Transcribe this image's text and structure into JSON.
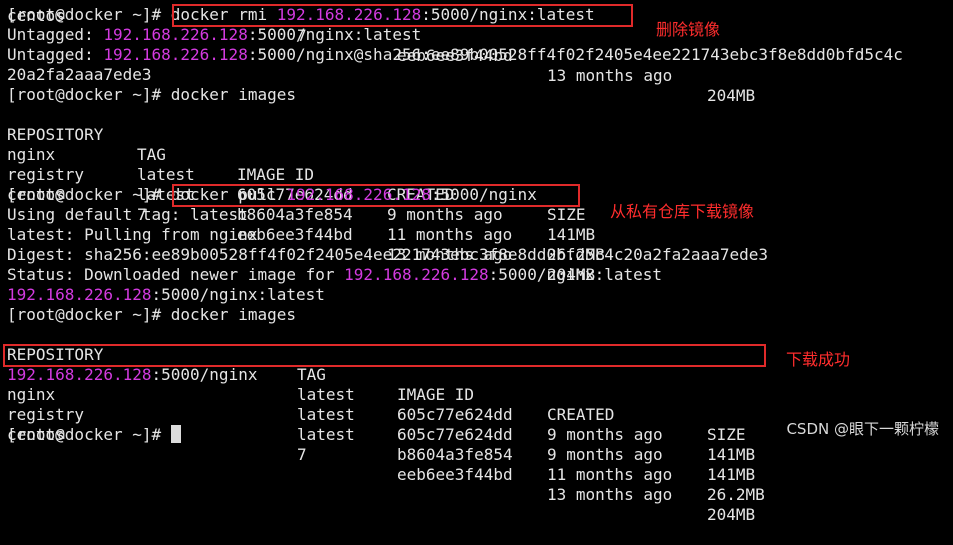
{
  "prompt": "[root@docker ~]#",
  "registry_ip": "192.168.226.128",
  "top_clip": {
    "col1": "centos",
    "col2": "7",
    "col3": "eeb6ee3f44bd",
    "col4": "13 months ago",
    "col5": "204MB"
  },
  "cmd1": {
    "text_pre": "docker rmi ",
    "text_post": ":5000/nginx:latest"
  },
  "untagged1": {
    "label": "Untagged: ",
    "post": ":5000/nginx:latest"
  },
  "untagged2": {
    "label": "Untagged: ",
    "post": ":5000/nginx@sha256:ee89b00528ff4f02f2405e4ee221743ebc3f8e8dd0bfd5c4c"
  },
  "untagged2_wrap": "20a2fa2aaa7ede3",
  "cmd2": " docker images",
  "table1": {
    "headers": [
      "REPOSITORY",
      "TAG",
      "IMAGE ID",
      "CREATED",
      "SIZE"
    ],
    "rows": [
      [
        "nginx",
        "latest",
        "605c77e624dd",
        "9 months ago",
        "141MB"
      ],
      [
        "registry",
        "latest",
        "b8604a3fe854",
        "11 months ago",
        "26.2MB"
      ],
      [
        "centos",
        "7",
        "eeb6ee3f44bd",
        "13 months ago",
        "204MB"
      ]
    ]
  },
  "cmd3": {
    "text_pre": "docker pull ",
    "text_post": ":5000/nginx"
  },
  "pull_output": {
    "line1": "Using default tag: latest",
    "line2": "latest: Pulling from nginx",
    "line3": "Digest: sha256:ee89b00528ff4f02f2405e4ee221743ebc3f8e8dd0bfd5c4c20a2fa2aaa7ede3",
    "line4_pre": "Status: Downloaded newer image for ",
    "line4_post": ":5000/nginx:latest",
    "line5_post": ":5000/nginx:latest"
  },
  "cmd4": " docker images",
  "table2": {
    "headers": [
      "REPOSITORY",
      "TAG",
      "IMAGE ID",
      "CREATED",
      "SIZE"
    ],
    "row0_repo_post": ":5000/nginx",
    "row0": [
      "latest",
      "605c77e624dd",
      "9 months ago",
      "141MB"
    ],
    "rows": [
      [
        "nginx",
        "latest",
        "605c77e624dd",
        "9 months ago",
        "141MB"
      ],
      [
        "registry",
        "latest",
        "b8604a3fe854",
        "11 months ago",
        "26.2MB"
      ],
      [
        "centos",
        "7",
        "eeb6ee3f44bd",
        "13 months ago",
        "204MB"
      ]
    ]
  },
  "annotations": {
    "delete": "删除镜像",
    "pull": "从私有仓库下载镜像",
    "success": "下载成功"
  },
  "watermark": "CSDN @眼下一颗柠檬",
  "colors": {
    "background": "#000000",
    "text": "#e5e5e5",
    "ip_highlight": "#d33be0",
    "annotation": "#ff2d2d"
  }
}
